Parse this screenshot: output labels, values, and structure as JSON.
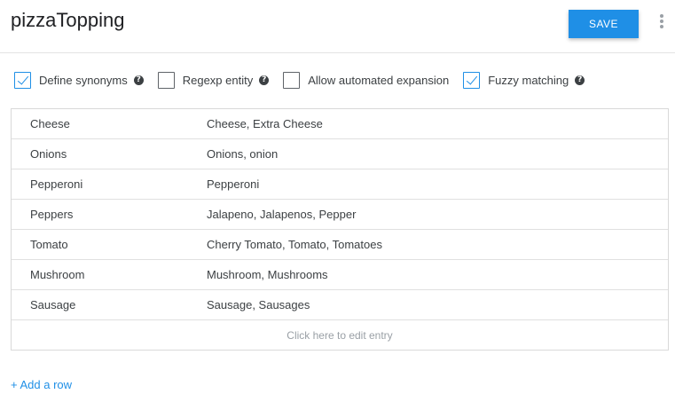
{
  "header": {
    "title": "pizzaTopping",
    "save_label": "SAVE"
  },
  "options": [
    {
      "label": "Define synonyms",
      "checked": true,
      "help": true
    },
    {
      "label": "Regexp entity",
      "checked": false,
      "help": true
    },
    {
      "label": "Allow automated expansion",
      "checked": false,
      "help": false
    },
    {
      "label": "Fuzzy matching",
      "checked": true,
      "help": true
    }
  ],
  "entries": [
    {
      "value": "Cheese",
      "synonyms": "Cheese, Extra Cheese"
    },
    {
      "value": "Onions",
      "synonyms": "Onions, onion"
    },
    {
      "value": "Pepperoni",
      "synonyms": "Pepperoni"
    },
    {
      "value": "Peppers",
      "synonyms": "Jalapeno, Jalapenos, Pepper"
    },
    {
      "value": "Tomato",
      "synonyms": "Cherry Tomato, Tomato, Tomatoes"
    },
    {
      "value": "Mushroom",
      "synonyms": "Mushroom, Mushrooms"
    },
    {
      "value": "Sausage",
      "synonyms": "Sausage, Sausages"
    }
  ],
  "edit_placeholder": "Click here to edit entry",
  "add_row_label": "+ Add a row",
  "colors": {
    "accent": "#1f8fe6",
    "border": "#d9d9d9",
    "muted": "#9aa0a6"
  },
  "icons": {
    "more": "more-vert-icon",
    "help": "help-circle-icon",
    "check": "check-icon"
  }
}
